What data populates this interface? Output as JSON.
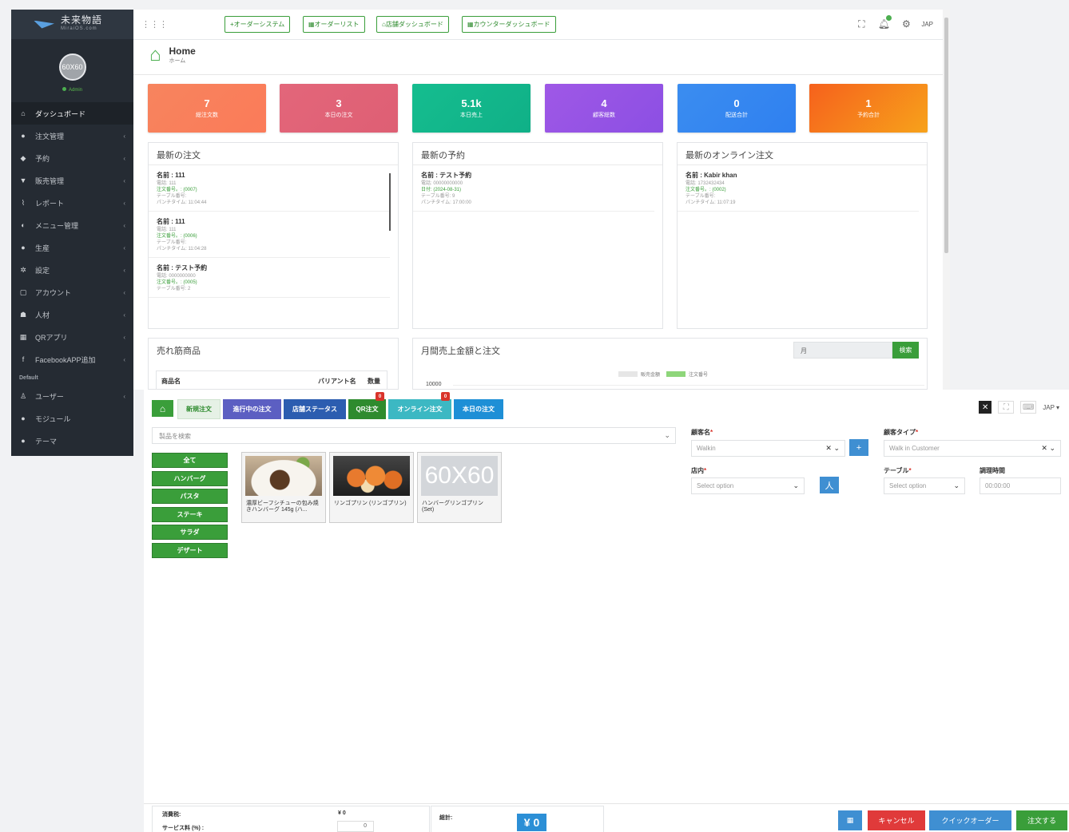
{
  "sidebar": {
    "brand": "未来物語",
    "brand_sub": "MiraiOS.com",
    "avatar_text": "60X60",
    "role": "Admin",
    "items": [
      {
        "icon": "⌂",
        "label": "ダッシュボード",
        "active": true,
        "chevron": ""
      },
      {
        "icon": "●",
        "label": "注文管理",
        "chevron": "‹"
      },
      {
        "icon": "◆",
        "label": "予約",
        "chevron": "‹"
      },
      {
        "icon": "▼",
        "label": "販売管理",
        "chevron": "‹"
      },
      {
        "icon": "⌇",
        "label": "レポート",
        "chevron": "‹"
      },
      {
        "icon": "◐",
        "label": "メニュー管理",
        "chevron": "‹"
      },
      {
        "icon": "●",
        "label": "生産",
        "chevron": "‹"
      },
      {
        "icon": "✲",
        "label": "設定",
        "chevron": "‹"
      },
      {
        "icon": "▢",
        "label": "アカウント",
        "chevron": "‹"
      },
      {
        "icon": "☗",
        "label": "人材",
        "chevron": "‹"
      },
      {
        "icon": "▦",
        "label": "QRアプリ",
        "chevron": "‹"
      },
      {
        "icon": "f",
        "label": "FacebookAPP追加",
        "chevron": "‹"
      }
    ],
    "section": "Default",
    "items2": [
      {
        "icon": "♙",
        "label": "ユーザー",
        "chevron": "‹"
      },
      {
        "icon": "●",
        "label": "モジュール",
        "chevron": ""
      },
      {
        "icon": "●",
        "label": "テーマ",
        "chevron": ""
      }
    ]
  },
  "topbar": {
    "buttons": [
      "+オーダーシステム",
      "▦オーダーリスト",
      "⌂店舗ダッシュボード",
      "▦カウンターダッシュボード"
    ],
    "lang": "JAP"
  },
  "dashboard": {
    "title": "Home",
    "subtitle": "ホーム",
    "stats": [
      {
        "value": "7",
        "label": "総注文数",
        "color": "#f7845e"
      },
      {
        "value": "3",
        "label": "本日の注文",
        "color": "#e3667a"
      },
      {
        "value": "5.1k",
        "label": "本日売上",
        "color": "#15bd8f"
      },
      {
        "value": "4",
        "label": "顧客総数",
        "color": "#9f58e6"
      },
      {
        "value": "0",
        "label": "配送合計",
        "color": "#3b8df0"
      },
      {
        "value": "1",
        "label": "予約合計",
        "color": "#f6611c"
      }
    ],
    "recent_orders": {
      "title": "最新の注文",
      "entries": [
        {
          "name": "名前 : 111",
          "lines": [
            "電話: 111",
            "注文番号。: (0007)",
            "テーブル番号:",
            "パンチタイム: 11:04:44"
          ]
        },
        {
          "name": "名前 : 111",
          "lines": [
            "電話: 111",
            "注文番号。: (0006)",
            "テーブル番号:",
            "パンチタイム: 11:04:28"
          ]
        },
        {
          "name": "名前 : テスト予約",
          "lines": [
            "電話: 0000000000",
            "注文番号。: (0005)",
            "テーブル番号: 2"
          ]
        }
      ]
    },
    "recent_reservations": {
      "title": "最新の予約",
      "entries": [
        {
          "name": "名前 : テスト予約",
          "lines": [
            "電話: 00000000000",
            "日付: (2024-08-31)",
            "テーブル番号: 9",
            "パンチタイム: 17:00:00"
          ]
        }
      ]
    },
    "recent_online": {
      "title": "最新のオンライン注文",
      "entries": [
        {
          "name": "名前 : Kabir khan",
          "lines": [
            "電話: 1732432434",
            "注文番号。: (0002)",
            "テーブル番号:",
            "パンチタイム: 11:07:19"
          ]
        }
      ]
    },
    "bestsellers": {
      "title": "売れ筋商品",
      "col_name": "商品名",
      "col_variant": "バリアント名",
      "col_qty": "数量"
    },
    "monthly": {
      "title": "月間売上金額と注文",
      "month_placeholder": "月",
      "search_label": "検索",
      "legend": [
        "販売金額",
        "注文番号"
      ],
      "ytick": "10000"
    }
  },
  "pos": {
    "tabs": [
      {
        "label": "新規注文",
        "bg": "#e6f1e6",
        "fg": "#2e8b2e",
        "badge": ""
      },
      {
        "label": "進行中の注文",
        "bg": "#5c5fc2",
        "fg": "#ffffff",
        "badge": ""
      },
      {
        "label": "店舗ステータス",
        "bg": "#2c5db0",
        "fg": "#ffffff",
        "badge": ""
      },
      {
        "label": "QR注文",
        "bg": "#2e8b2e",
        "fg": "#ffffff",
        "badge": "0"
      },
      {
        "label": "オンライン注文",
        "bg": "#3cb8c3",
        "fg": "#ffffff",
        "badge": "0"
      },
      {
        "label": "本日の注文",
        "bg": "#1e8fd6",
        "fg": "#ffffff",
        "badge": ""
      }
    ],
    "lang": "JAP ▾",
    "product_search_placeholder": "製品を検索",
    "categories": [
      "全て",
      "ハンバーグ",
      "パスタ",
      "ステーキ",
      "サラダ",
      "デザート"
    ],
    "products": [
      {
        "name": "濃厚ビーフシチューの包み焼きハンバーグ 145g (ハ...",
        "img": "steak"
      },
      {
        "name": "リンゴプリン (リンゴプリン)",
        "img": "apple"
      },
      {
        "name": "ハンバーグリンゴプリン (Set)",
        "img": "placeholder",
        "placeholder_text": "60X60"
      }
    ],
    "form": {
      "customer_name_label": "顧客名",
      "customer_name_value": "Walkin",
      "customer_type_label": "顧客タイプ",
      "customer_type_value": "Walk in Customer",
      "store_label": "店内",
      "store_placeholder": "Select option",
      "table_label": "テーブル",
      "table_placeholder": "Select option",
      "cook_time_label": "調理時間",
      "cook_time_value": "00:00:00"
    },
    "footer": {
      "tax_label": "消費税:",
      "tax_value": "¥ 0",
      "service_label": "サービス料 (%) :",
      "service_value": "0",
      "total_label": "総計:",
      "total_value": "¥ 0",
      "cancel_label": "キャンセル",
      "quick_label": "クイックオーダー",
      "order_label": "注文する"
    }
  }
}
